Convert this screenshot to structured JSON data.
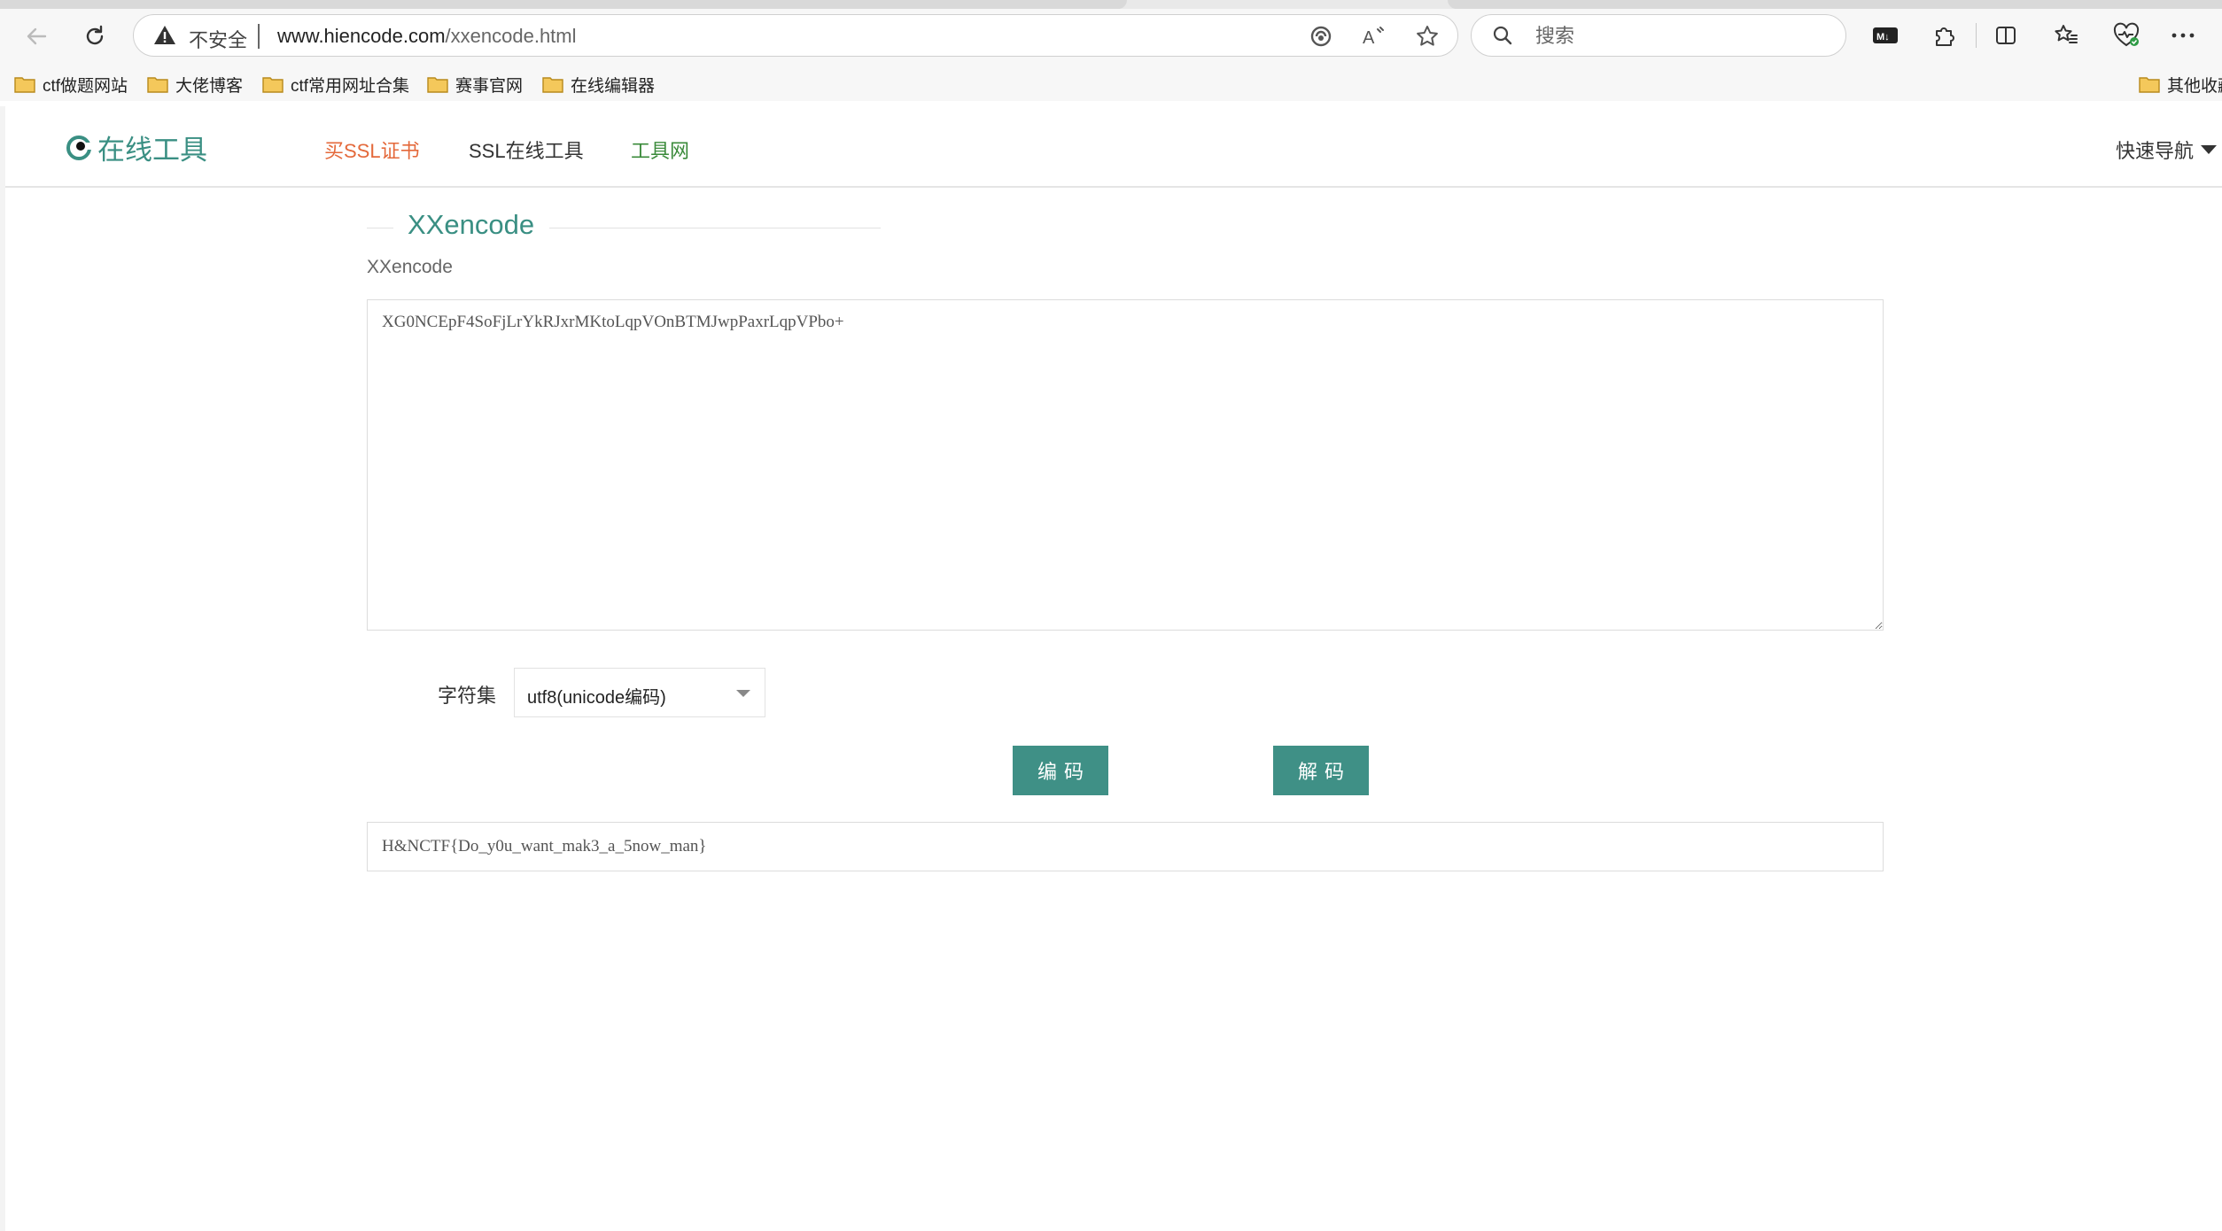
{
  "browser": {
    "address_bar": {
      "security_label": "不安全",
      "url_host": "www.hiencode.com",
      "url_path": "/xxencode.html"
    },
    "search": {
      "placeholder": "搜索"
    },
    "bookmarks": [
      {
        "label": "ctf做题网站"
      },
      {
        "label": "大佬博客"
      },
      {
        "label": "ctf常用网址合集"
      },
      {
        "label": "赛事官网"
      },
      {
        "label": "在线编辑器"
      }
    ],
    "other_bookmarks_label": "其他收藏"
  },
  "site": {
    "logo_text": "在线工具",
    "nav": {
      "buy_ssl": "买SSL证书",
      "ssl_tools": "SSL在线工具",
      "tool_net": "工具网",
      "quick_nav": "快速导航"
    },
    "colors": {
      "accent": "#3f9086",
      "nav_orange": "#e4693b",
      "nav_green": "#3a8a3a"
    }
  },
  "main": {
    "title": "XXencode",
    "subtitle": "XXencode",
    "input_value": "XG0NCEpF4SoFjLrYkRJxrMKtoLqpVOnBTMJwpPaxrLqpVPbo+",
    "charset_label": "字符集",
    "charset_selected": "utf8(unicode编码)",
    "encode_label": "编码",
    "decode_label": "解码",
    "output_value": "H&NCTF{Do_y0u_want_mak3_a_5now_man}"
  }
}
